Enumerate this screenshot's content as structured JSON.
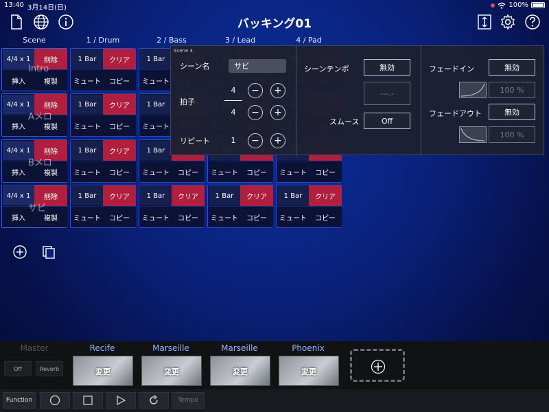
{
  "status_bar": {
    "time": "13:40",
    "date": "3月14日(日)",
    "battery": "100%"
  },
  "title": "バッキング01",
  "icons": {
    "new": "document-icon",
    "globe": "globe-icon",
    "info": "info-icon",
    "resize": "resize-icon",
    "settings": "gear-icon",
    "help": "help-icon"
  },
  "column_headers": [
    "Scene",
    "1 / Drum",
    "2 / Bass",
    "3 / Lead",
    "4 / Pad"
  ],
  "scenes": [
    {
      "meter": "4/4 x 1",
      "delete": "削除",
      "insert": "挿入",
      "duplicate": "複製",
      "name": "Intro"
    },
    {
      "meter": "4/4 x 1",
      "delete": "削除",
      "insert": "挿入",
      "duplicate": "複製",
      "name": "Aメロ"
    },
    {
      "meter": "4/4 x 1",
      "delete": "削除",
      "insert": "挿入",
      "duplicate": "複製",
      "name": "Bメロ"
    },
    {
      "meter": "4/4 x 1",
      "delete": "削除",
      "insert": "挿入",
      "duplicate": "複製",
      "name": "サビ"
    }
  ],
  "track_cell": {
    "length": "1 Bar",
    "clear": "クリア",
    "mute": "ミュート",
    "copy": "コピー"
  },
  "popup": {
    "section": "Scene 4",
    "scene_name_label": "シーン名",
    "scene_name_value": "サビ",
    "time_sig_label": "拍子",
    "numerator": "4",
    "denominator": "4",
    "repeat_label": "リピート",
    "repeat_value": "1",
    "minus": "−",
    "plus": "+",
    "tempo_label": "シーンテンポ",
    "tempo_value": "無効",
    "tempo_display": "---.-",
    "smooth_label": "スムース",
    "smooth_value": "Off",
    "fadein_label": "フェードイン",
    "fadein_value": "無効",
    "fadein_percent": "100 %",
    "fadeout_label": "フェードアウト",
    "fadeout_value": "無効",
    "fadeout_percent": "100 %"
  },
  "bottom": {
    "master_label": "Master",
    "master_off": "Off",
    "master_reverb": "Reverb",
    "slots": [
      {
        "name": "Recife",
        "change": "変更"
      },
      {
        "name": "Marseille",
        "change": "変更"
      },
      {
        "name": "Marseille",
        "change": "変更"
      },
      {
        "name": "Phoenix",
        "change": "変更"
      }
    ],
    "slot_name_color": "#8fb4ff"
  },
  "transport": {
    "function": "Function",
    "tempo": "Tempo"
  }
}
